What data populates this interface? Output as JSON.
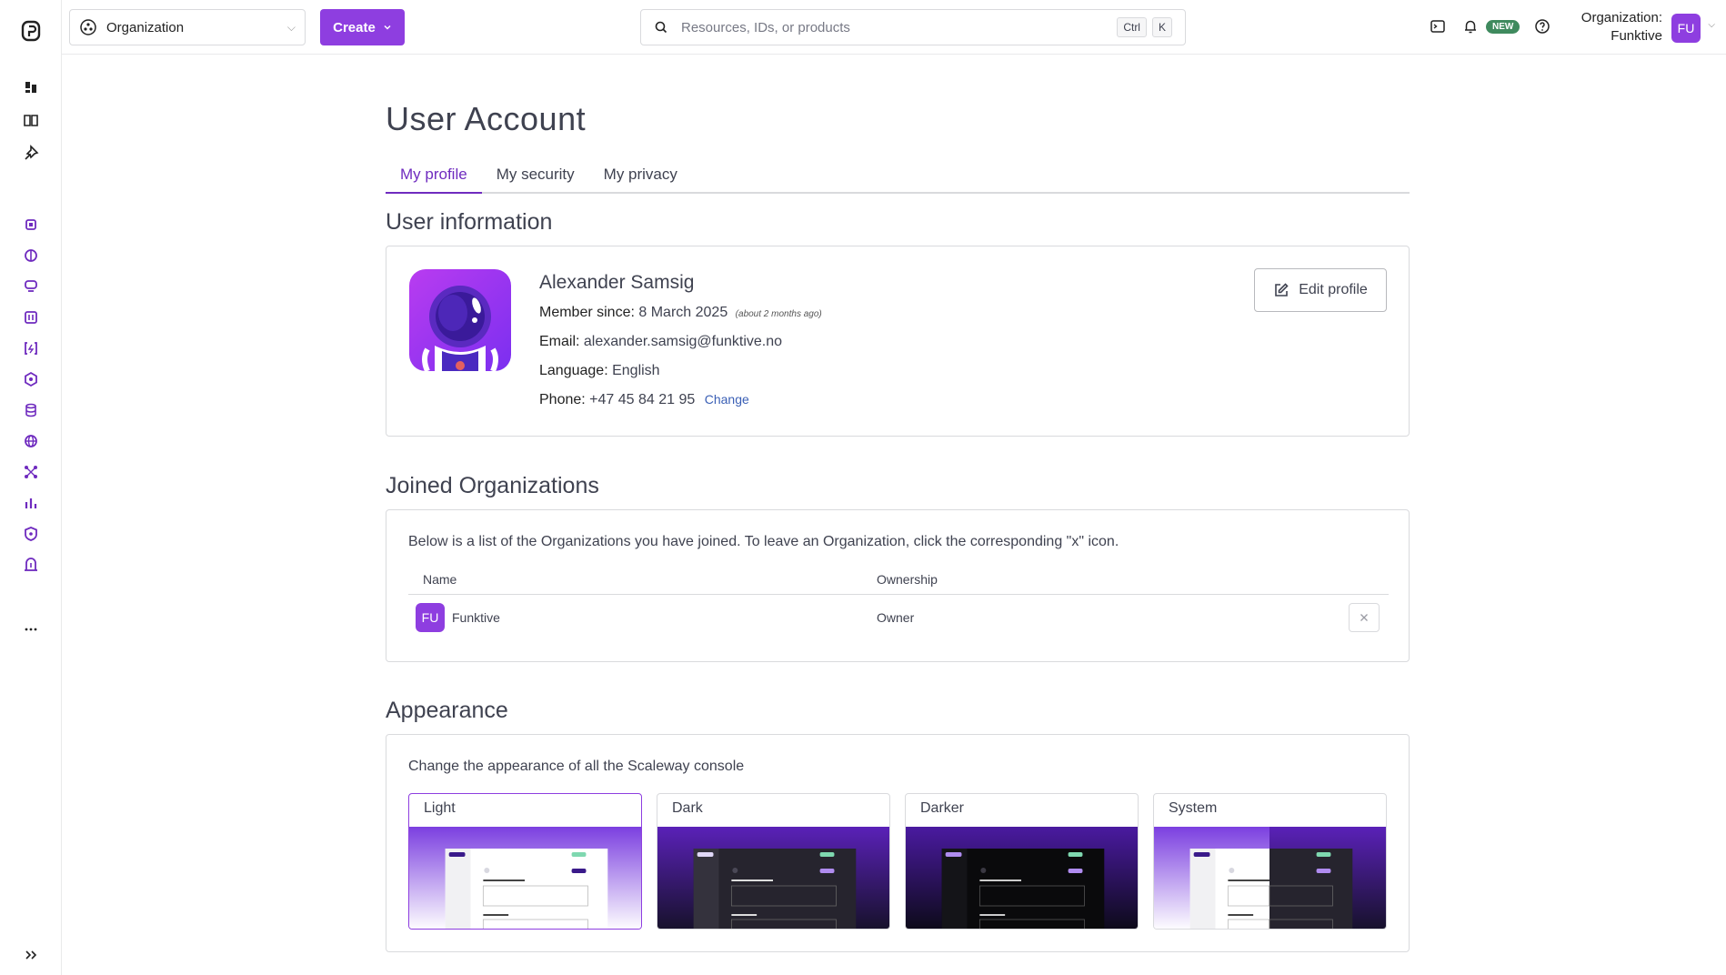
{
  "topbar": {
    "org_select_label": "Organization",
    "create_label": "Create",
    "search_placeholder": "Resources, IDs, or products",
    "kbd_ctrl": "Ctrl",
    "kbd_k": "K",
    "new_badge": "NEW",
    "org_prefix": "Organization:",
    "org_name": "Funktive",
    "avatar_initials": "FU"
  },
  "page": {
    "title": "User Account",
    "tabs": [
      {
        "label": "My profile",
        "active": true
      },
      {
        "label": "My security",
        "active": false
      },
      {
        "label": "My privacy",
        "active": false
      }
    ]
  },
  "user_info": {
    "section_title": "User information",
    "name": "Alexander Samsig",
    "member_since_label": "Member since:",
    "member_since_value": "8 March 2025",
    "member_since_relative": "(about 2 months ago)",
    "email_label": "Email:",
    "email_value": "alexander.samsig@funktive.no",
    "language_label": "Language:",
    "language_value": "English",
    "phone_label": "Phone:",
    "phone_value": "+47 45 84 21 95",
    "change_link": "Change",
    "edit_button": "Edit profile"
  },
  "organizations": {
    "section_title": "Joined Organizations",
    "description": "Below is a list of the Organizations you have joined. To leave an Organization, click the corresponding \"x\" icon.",
    "columns": [
      "Name",
      "Ownership"
    ],
    "rows": [
      {
        "initials": "FU",
        "name": "Funktive",
        "ownership": "Owner"
      }
    ]
  },
  "appearance": {
    "section_title": "Appearance",
    "description": "Change the appearance of all the Scaleway console",
    "themes": [
      {
        "label": "Light",
        "selected": true
      },
      {
        "label": "Dark",
        "selected": false
      },
      {
        "label": "Darker",
        "selected": false
      },
      {
        "label": "System",
        "selected": false
      }
    ]
  },
  "colors": {
    "accent": "#8e3ee0",
    "tab_active": "#6f2bbf",
    "link": "#3a5fb5",
    "new_badge": "#3f8a5e"
  }
}
